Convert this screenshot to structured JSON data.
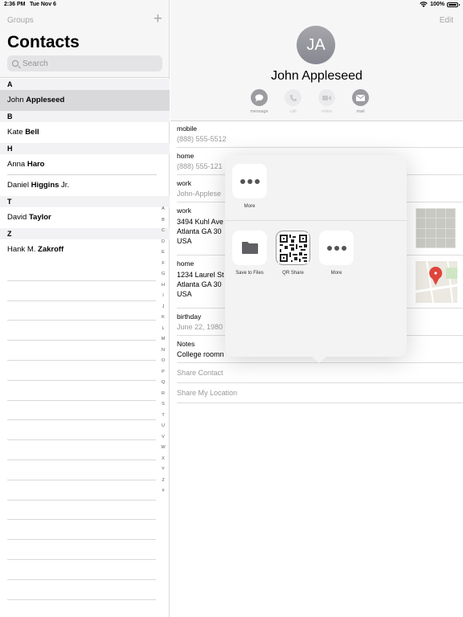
{
  "status_bar": {
    "time": "2:36 PM",
    "date": "Tue Nov 6",
    "battery": "100%"
  },
  "sidebar": {
    "groups_label": "Groups",
    "add_label": "+",
    "title": "Contacts",
    "search_placeholder": "Search",
    "sections": [
      {
        "letter": "A",
        "contacts": [
          {
            "first": "John ",
            "last": "Appleseed",
            "suffix": ""
          }
        ]
      },
      {
        "letter": "B",
        "contacts": [
          {
            "first": "Kate ",
            "last": "Bell",
            "suffix": ""
          }
        ]
      },
      {
        "letter": "H",
        "contacts": [
          {
            "first": "Anna ",
            "last": "Haro",
            "suffix": ""
          },
          {
            "first": "Daniel ",
            "last": "Higgins",
            "suffix": " Jr."
          }
        ]
      },
      {
        "letter": "T",
        "contacts": [
          {
            "first": "David ",
            "last": "Taylor",
            "suffix": ""
          }
        ]
      },
      {
        "letter": "Z",
        "contacts": [
          {
            "first": "Hank M. ",
            "last": "Zakroff",
            "suffix": ""
          }
        ]
      }
    ],
    "index": [
      "A",
      "B",
      "C",
      "D",
      "E",
      "F",
      "G",
      "H",
      "I",
      "J",
      "K",
      "L",
      "M",
      "N",
      "O",
      "P",
      "Q",
      "R",
      "S",
      "T",
      "U",
      "V",
      "W",
      "X",
      "Y",
      "Z",
      "#"
    ]
  },
  "detail": {
    "edit_label": "Edit",
    "initials": "JA",
    "name": "John Appleseed",
    "actions": {
      "message": "message",
      "call": "call",
      "video": "video",
      "mail": "mail"
    },
    "fields": {
      "mobile": {
        "label": "mobile",
        "value": "(888) 555-5512"
      },
      "home_phone": {
        "label": "home",
        "value": "(888) 555-121"
      },
      "work_email": {
        "label": "work",
        "value": "John-Applese"
      },
      "work_address": {
        "label": "work",
        "line1": "3494 Kuhl Ave",
        "line2": "Atlanta GA 30",
        "line3": "USA"
      },
      "home_address": {
        "label": "home",
        "line1": "1234 Laurel St",
        "line2": "Atlanta GA 30",
        "line3": "USA"
      },
      "birthday": {
        "label": "birthday",
        "value": "June 22, 1980"
      },
      "notes": {
        "label": "Notes",
        "value": "College roomn"
      }
    },
    "share_contact": "Share Contact",
    "share_location": "Share My Location"
  },
  "share_sheet": {
    "top_more": "More",
    "save_to_files": "Save to Files",
    "qr_share": "QR Share",
    "bottom_more": "More"
  }
}
